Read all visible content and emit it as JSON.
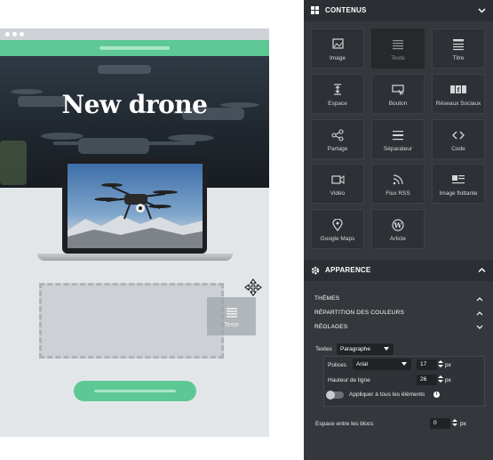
{
  "preview": {
    "hero_title": "New drone",
    "drag_tile_label": "Texte"
  },
  "panel": {
    "contenus": {
      "title": "CONTENUS",
      "icon": "grid-icon",
      "tiles": [
        {
          "label": "Image",
          "icon": "image-icon",
          "active": false
        },
        {
          "label": "Texte",
          "icon": "text-icon",
          "active": true
        },
        {
          "label": "Titre",
          "icon": "title-icon",
          "active": false
        },
        {
          "label": "Espace",
          "icon": "space-icon",
          "active": false
        },
        {
          "label": "Bouton",
          "icon": "button-icon",
          "active": false
        },
        {
          "label": "Réseaux Sociaux",
          "icon": "social-icon",
          "active": false
        },
        {
          "label": "Partage",
          "icon": "share-icon",
          "active": false
        },
        {
          "label": "Séparateur",
          "icon": "separator-icon",
          "active": false
        },
        {
          "label": "Code",
          "icon": "code-icon",
          "active": false
        },
        {
          "label": "Vidéo",
          "icon": "video-icon",
          "active": false
        },
        {
          "label": "Flux RSS",
          "icon": "rss-icon",
          "active": false
        },
        {
          "label": "Image flottante",
          "icon": "floating-image-icon",
          "active": false
        },
        {
          "label": "Google Maps",
          "icon": "map-pin-icon",
          "active": false
        },
        {
          "label": "Article",
          "icon": "wordpress-icon",
          "active": false
        }
      ]
    },
    "apparence": {
      "title": "APPARENCE",
      "icon": "gear-icon",
      "rows": {
        "themes": "THÈMES",
        "colors": "RÉPARTITION DES COULEURS",
        "reglages": "RÉGLAGES"
      },
      "textes_label": "Textes",
      "textes_value": "Paragraphe",
      "polices_label": "Polices",
      "polices_value": "Arial",
      "font_size": "17",
      "line_height_label": "Hauteur de ligne",
      "line_height": "26",
      "unit": "px",
      "apply_all_label": "Appliquer à tous les éléments",
      "block_spacing_label": "Espace entre les blocs",
      "block_spacing": "0"
    }
  },
  "colors": {
    "panel_bg": "#34383c",
    "accent_green": "#5ec895"
  }
}
